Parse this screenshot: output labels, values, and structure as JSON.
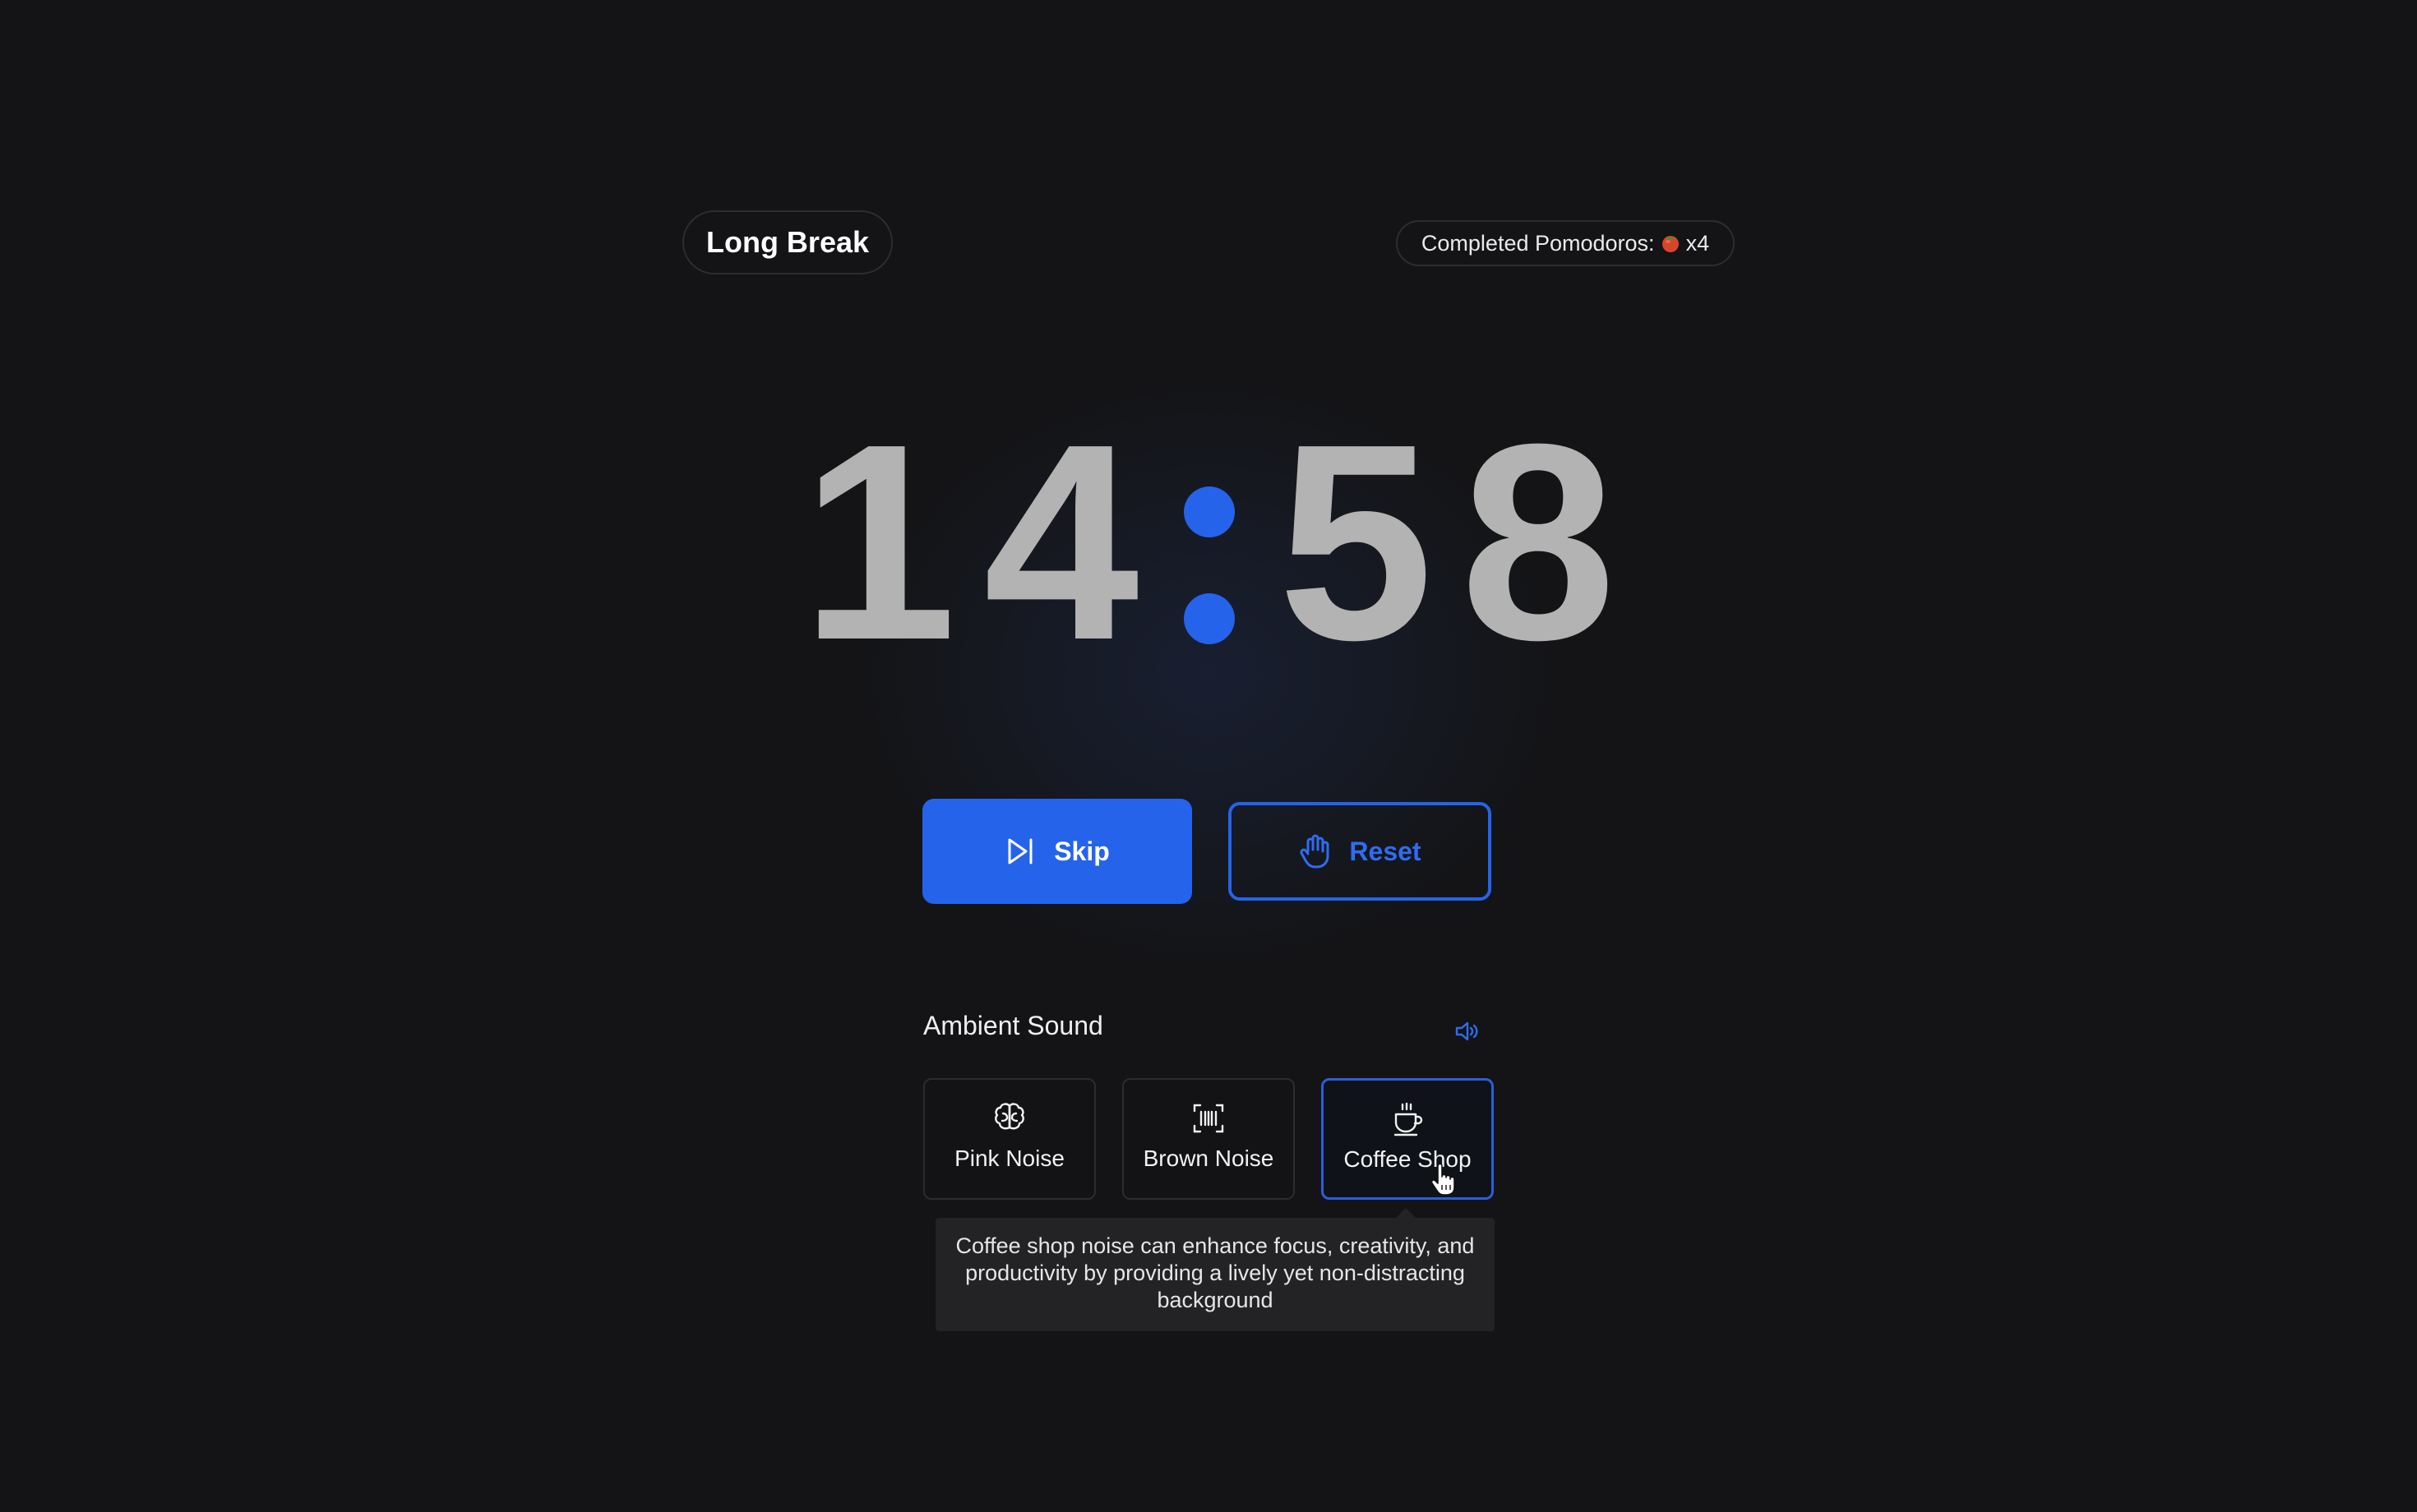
{
  "header": {
    "mode_label": "Long Break",
    "completed_label": "Completed Pomodoros:",
    "completed_icon": "tomato-icon",
    "completed_count": "x4"
  },
  "timer": {
    "minutes_tens": "1",
    "minutes_ones": "4",
    "seconds_tens": "5",
    "seconds_ones": "8",
    "separator_color": "#2563eb"
  },
  "controls": {
    "skip_label": "Skip",
    "skip_icon": "skip-forward-icon",
    "reset_label": "Reset",
    "reset_icon": "hand-icon",
    "accent_color": "#2563eb"
  },
  "ambient": {
    "title": "Ambient Sound",
    "volume_icon": "volume-icon",
    "options": [
      {
        "label": "Pink Noise",
        "icon": "brain-icon",
        "selected": false
      },
      {
        "label": "Brown Noise",
        "icon": "barcode-scan-icon",
        "selected": false
      },
      {
        "label": "Coffee Shop",
        "icon": "coffee-cup-icon",
        "selected": true
      }
    ],
    "tooltip": "Coffee shop noise can enhance focus, creativity, and productivity by providing a lively yet non-distracting background"
  }
}
